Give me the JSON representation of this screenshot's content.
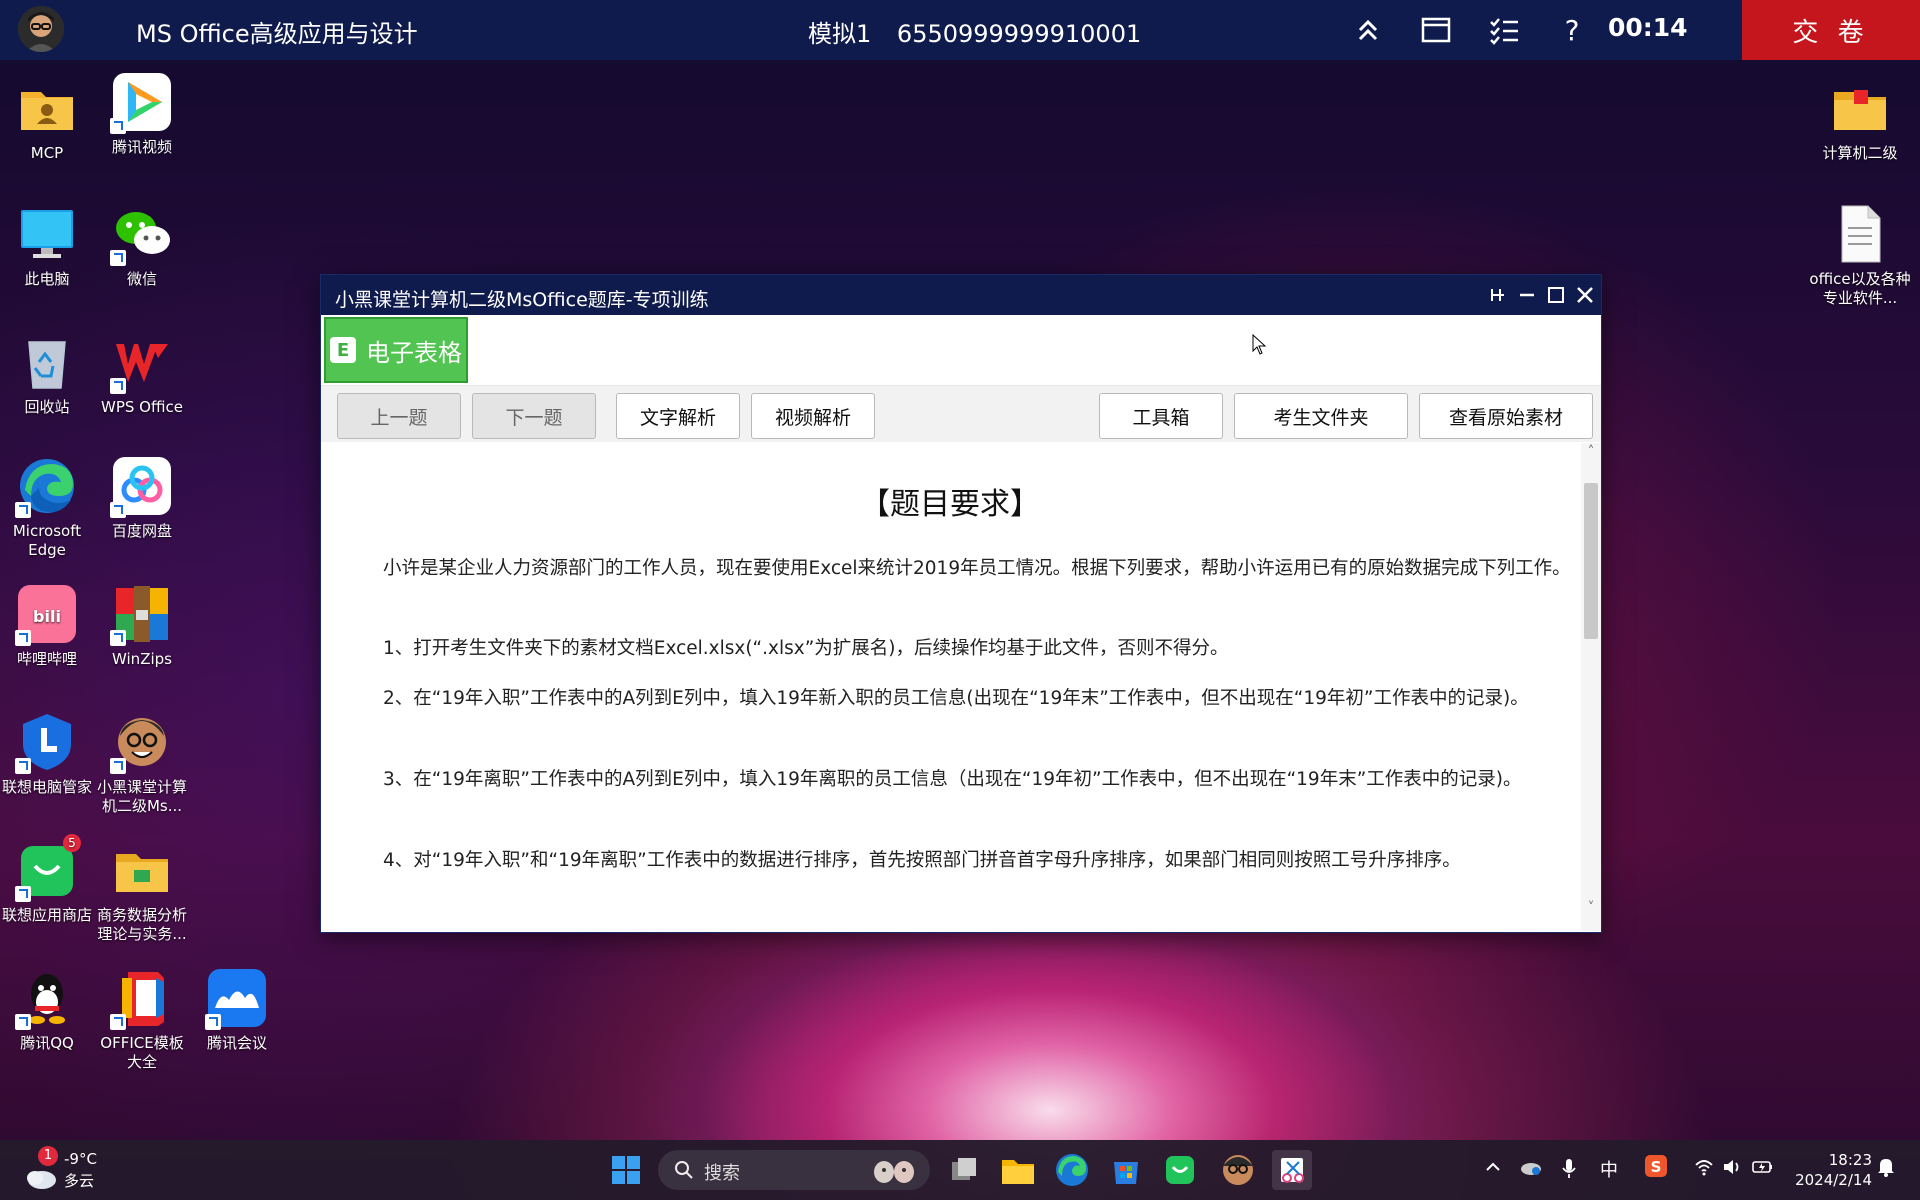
{
  "topbar": {
    "app_title": "MS Office高级应用与设计",
    "exam_mode": "模拟1",
    "exam_id": "6550999999910001",
    "timer": "00:14",
    "submit_label": "交 卷"
  },
  "desktop_icons_left": [
    {
      "label": "MCP",
      "icon": "folder-user-icon"
    },
    {
      "label": "腾讯视频",
      "icon": "tencent-video-icon"
    },
    {
      "label": "此电脑",
      "icon": "monitor-icon"
    },
    {
      "label": "微信",
      "icon": "wechat-icon"
    },
    {
      "label": "回收站",
      "icon": "recycle-bin-icon"
    },
    {
      "label": "WPS Office",
      "icon": "wps-icon"
    },
    {
      "label": "Microsoft Edge",
      "icon": "edge-icon"
    },
    {
      "label": "百度网盘",
      "icon": "baidu-netdisk-icon"
    },
    {
      "label": "哔哩哔哩",
      "icon": "bilibili-icon"
    },
    {
      "label": "WinZips",
      "icon": "winzips-icon"
    },
    {
      "label": "联想电脑管家",
      "icon": "lenovo-manager-icon"
    },
    {
      "label": "小黑课堂计算机二级Ms...",
      "icon": "xiaohei-avatar-icon"
    },
    {
      "label": "联想应用商店",
      "icon": "lenovo-store-icon",
      "badge": "5"
    },
    {
      "label": "商务数据分析理论与实务...",
      "icon": "folder-icon"
    },
    {
      "label": "腾讯QQ",
      "icon": "qq-icon"
    },
    {
      "label": "OFFICE模板大全",
      "icon": "office-icon"
    },
    {
      "label": "腾讯会议",
      "icon": "tencent-meeting-icon"
    }
  ],
  "desktop_icons_right": [
    {
      "label": "计算机二级",
      "icon": "folder-icon"
    },
    {
      "label": "office以及各种专业软件...",
      "icon": "document-icon"
    }
  ],
  "window": {
    "title": "小黑课堂计算机二级MsOffice题库-专项训练",
    "tab_badge": "E",
    "tab_label": "电子表格",
    "buttons": {
      "prev": "上一题",
      "next": "下一题",
      "text_analysis": "文字解析",
      "video_analysis": "视频解析",
      "toolbox": "工具箱",
      "student_folder": "考生文件夹",
      "view_material": "查看原始素材"
    },
    "heading": "【题目要求】",
    "paragraphs": [
      "小许是某企业人力资源部门的工作人员，现在要使用Excel来统计2019年员工情况。根据下列要求，帮助小许运用已有的原始数据完成下列工作。",
      "1、打开考生文件夹下的素材文档Excel.xlsx(“.xlsx”为扩展名)，后续操作均基于此文件，否则不得分。",
      "2、在“19年入职”工作表中的A列到E列中，填入19年新入职的员工信息(出现在“19年末”工作表中，但不出现在“19年初”工作表中的记录)。",
      "3、在“19年离职”工作表中的A列到E列中，填入19年离职的员工信息（出现在“19年初”工作表中，但不出现在“19年末”工作表中的记录)。",
      "4、对“19年入职”和“19年离职”工作表中的数据进行排序，首先按照部门拼音首字母升序排序，如果部门相同则按照工号升序排序。"
    ]
  },
  "taskbar": {
    "weather_badge": "1",
    "temperature": "-9°C",
    "condition": "多云",
    "search_placeholder": "搜索",
    "ime": "中",
    "time": "18:23",
    "date": "2024/2/14"
  }
}
